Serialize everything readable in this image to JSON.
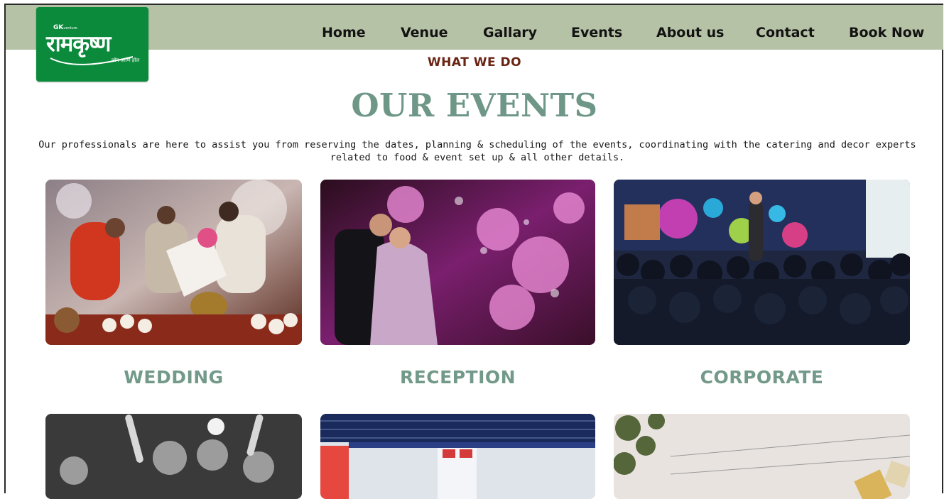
{
  "brand": {
    "prefix": "GK",
    "prefix_small": "venture",
    "name": "रामकृष्ण",
    "tagline": "लॉन आणि हॉल",
    "color": "#0b8a3b"
  },
  "nav": {
    "items": [
      {
        "label": "Home"
      },
      {
        "label": "Venue"
      },
      {
        "label": "Gallary"
      },
      {
        "label": "Events"
      },
      {
        "label": "About us"
      },
      {
        "label": "Contact"
      },
      {
        "label": "Book Now"
      }
    ],
    "background": "#b6c2a6"
  },
  "section": {
    "eyebrow": "WHAT WE DO",
    "title": "OUR EVENTS",
    "intro": "Our professionals are here to assist you from reserving the dates, planning & scheduling of the events, coordinating with the catering and decor experts related to food & event set up & all other details.",
    "accent": "#6f9788"
  },
  "events": [
    {
      "label": "WEDDING",
      "image": "wedding-ceremony-photo"
    },
    {
      "label": "RECEPTION",
      "image": "reception-couple-photo"
    },
    {
      "label": "CORPORATE",
      "image": "corporate-seminar-photo"
    },
    {
      "image": "party-crowd-photo"
    },
    {
      "image": "exhibition-hall-photo"
    },
    {
      "image": "outdoor-lawn-photo"
    }
  ]
}
